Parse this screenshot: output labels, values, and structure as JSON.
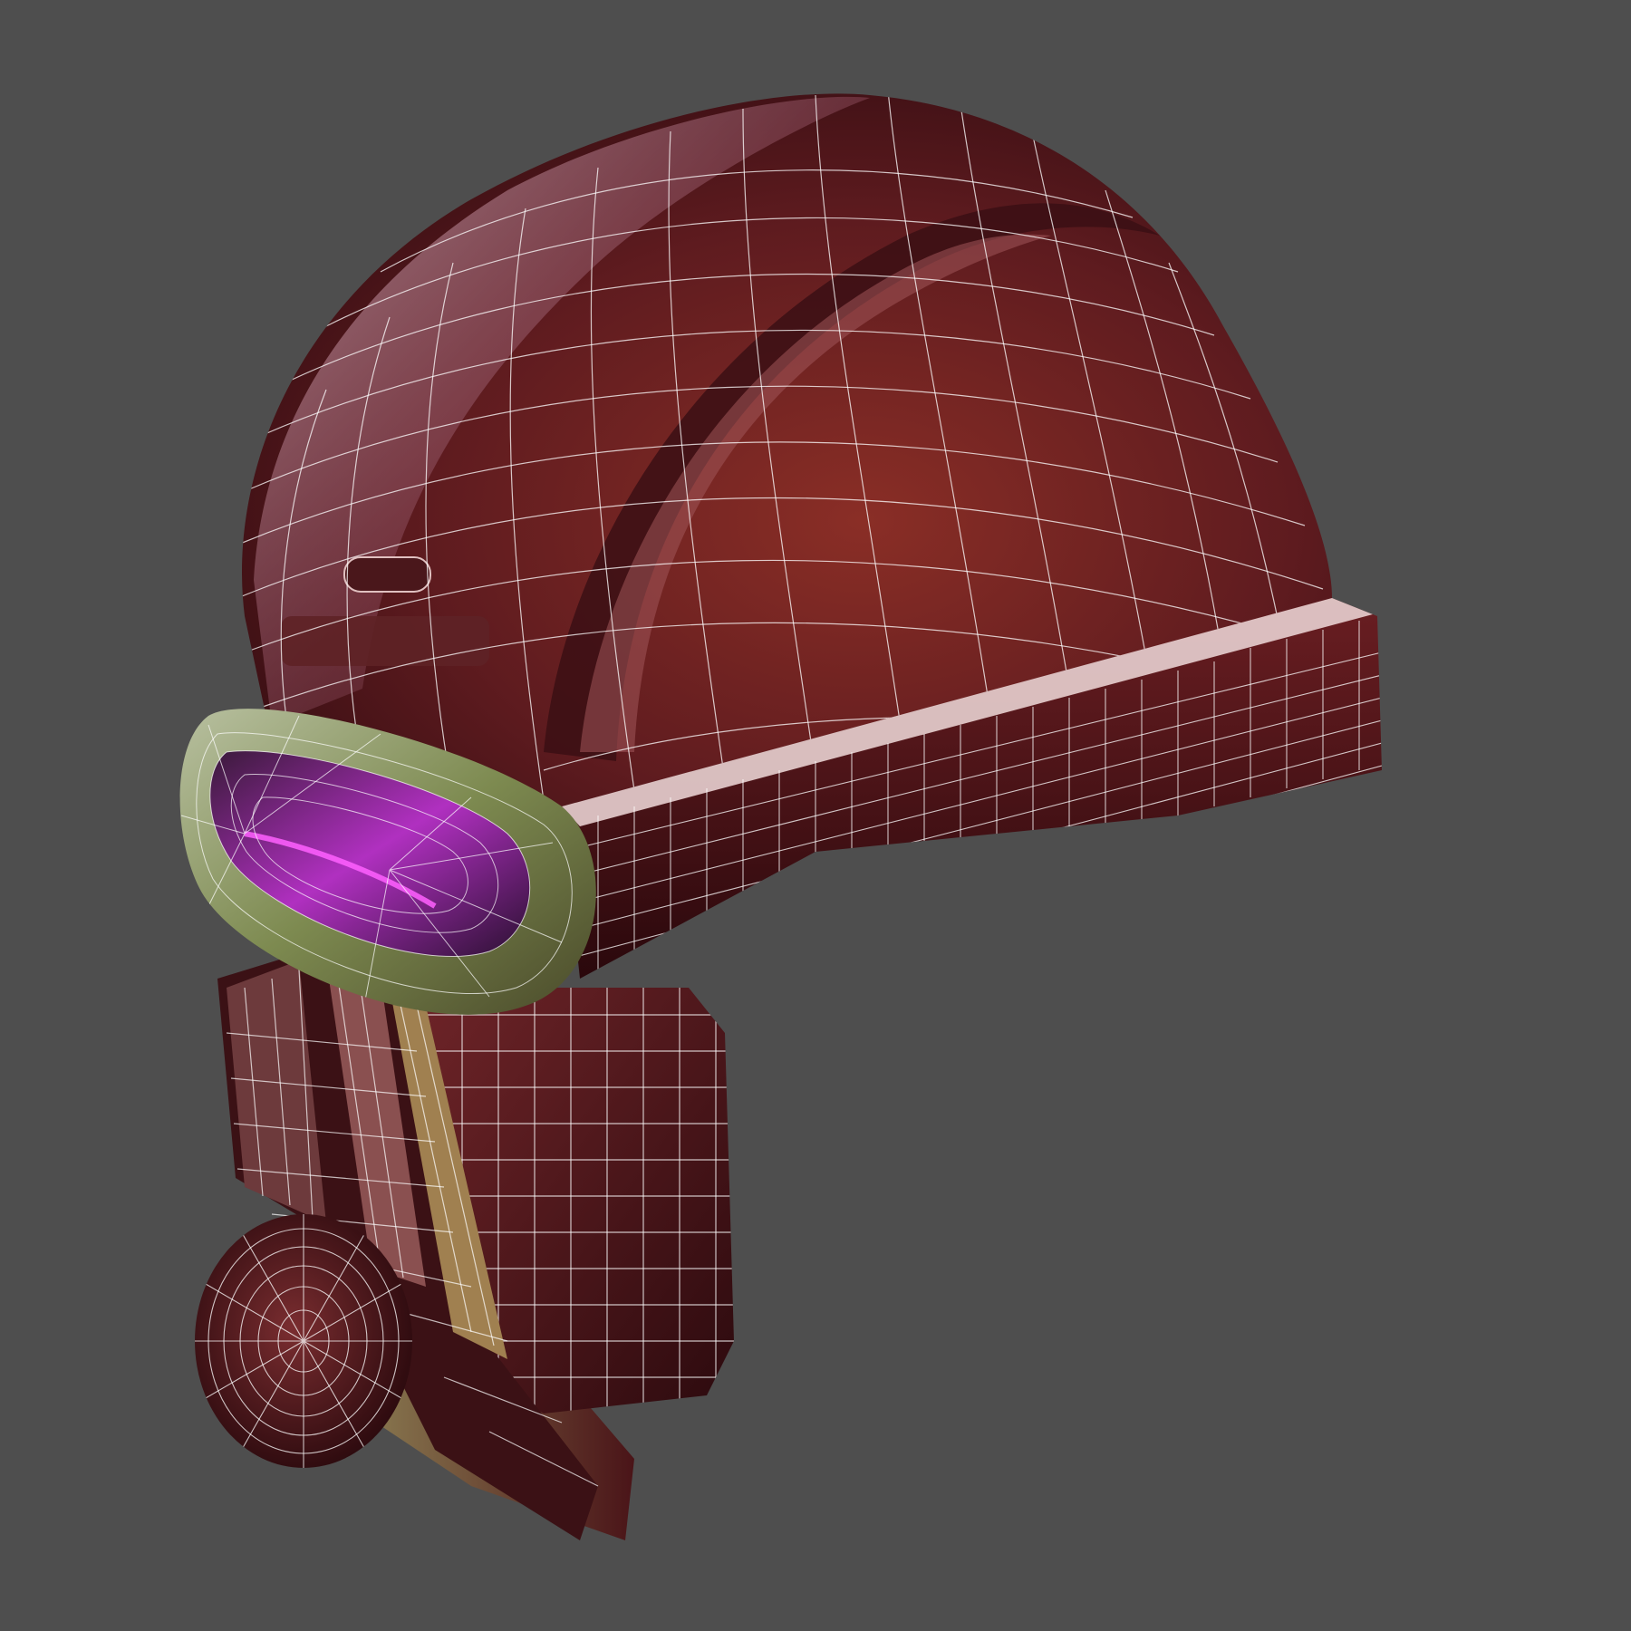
{
  "viewport": {
    "background_color": "#4e4e4e"
  },
  "model": {
    "subject": "helmet",
    "display_mode": "wireframe-over-shaded",
    "colors": {
      "shell_base": "#5a1a1e",
      "shell_highlight": "#b07a8a",
      "shell_mid": "#7a2a2a",
      "shell_shadow": "#2a0a0e",
      "visor_rim": "#8a8f5a",
      "visor_glow": "#d040d0",
      "wire": "#ffffff"
    }
  }
}
